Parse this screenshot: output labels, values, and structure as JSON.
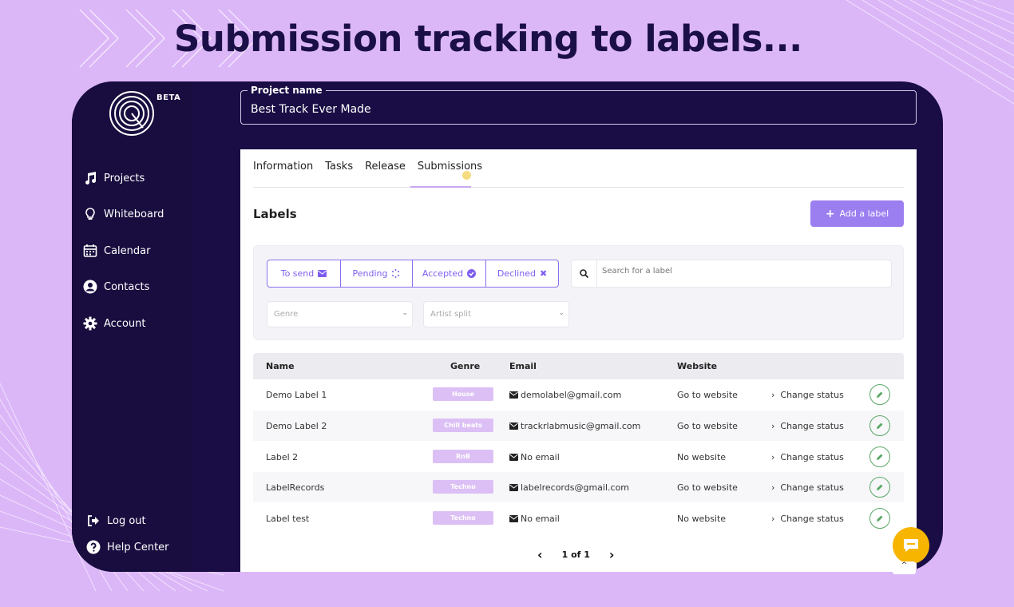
{
  "headline": "Submission tracking to labels...",
  "colors": {
    "bg": "#dcb7f8",
    "app": "#1a0d45",
    "accent": "#9b7ef0",
    "chat": "#f7b500"
  },
  "sidebar": {
    "badge": "BETA",
    "items": [
      {
        "label": "Projects",
        "icon": "music-note-icon"
      },
      {
        "label": "Whiteboard",
        "icon": "lightbulb-icon"
      },
      {
        "label": "Calendar",
        "icon": "calendar-icon"
      },
      {
        "label": "Contacts",
        "icon": "user-circle-icon"
      },
      {
        "label": "Account",
        "icon": "gear-icon"
      }
    ],
    "bottom": [
      {
        "label": "Log out",
        "icon": "logout-icon"
      },
      {
        "label": "Help Center",
        "icon": "help-icon"
      }
    ]
  },
  "project": {
    "legend": "Project name",
    "value": "Best Track Ever Made"
  },
  "tabs": [
    "Information",
    "Tasks",
    "Release",
    "Submissions"
  ],
  "section": {
    "title": "Labels",
    "add_button": "Add a label"
  },
  "filters": {
    "statuses": [
      "To send",
      "Pending",
      "Accepted",
      "Declined"
    ],
    "search_placeholder": "Search for a label",
    "genre_placeholder": "Genre",
    "split_placeholder": "Artist split"
  },
  "table": {
    "headers": [
      "Name",
      "Genre",
      "Email",
      "Website"
    ],
    "rows": [
      {
        "name": "Demo Label 1",
        "genre": "House",
        "email": "demolabel@gmail.com",
        "website": "Go to website",
        "action": "Change status"
      },
      {
        "name": "Demo Label 2",
        "genre": "Chill beats",
        "email": "trackrlabmusic@gmail.com",
        "website": "Go to website",
        "action": "Change status"
      },
      {
        "name": "Label 2",
        "genre": "RnB",
        "email": "No email",
        "website": "No website",
        "action": "Change status"
      },
      {
        "name": "LabelRecords",
        "genre": "Techno",
        "email": "labelrecords@gmail.com",
        "website": "Go to website",
        "action": "Change status"
      },
      {
        "name": "Label test",
        "genre": "Techno",
        "email": "No email",
        "website": "No website",
        "action": "Change status"
      }
    ]
  },
  "pager": {
    "prev": "‹",
    "label": "1 of 1",
    "next": "›"
  },
  "scroll_up": "^"
}
